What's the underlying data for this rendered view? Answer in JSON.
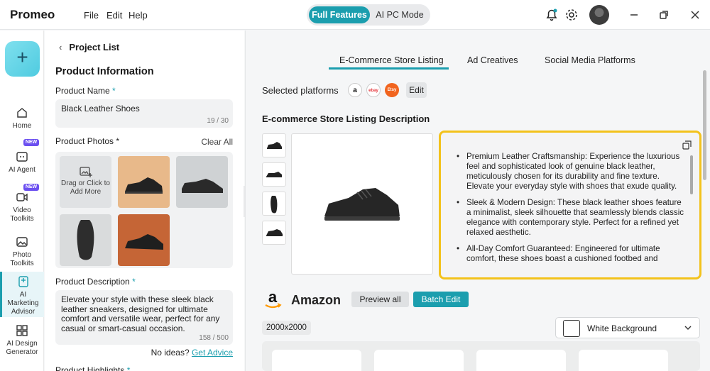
{
  "app": {
    "title": "Promeo"
  },
  "menu": {
    "file": "File",
    "edit": "Edit",
    "help": "Help"
  },
  "mode": {
    "active": "Full Features",
    "inactive": "AI PC Mode"
  },
  "rail": {
    "create_symbol": "+",
    "items": [
      {
        "label": "Home",
        "icon": "home-icon"
      },
      {
        "label": "AI Agent",
        "icon": "ai-agent-icon",
        "badge": "NEW"
      },
      {
        "label": "Video Toolkits",
        "icon": "video-icon",
        "badge": "NEW"
      },
      {
        "label": "Photo Toolkits",
        "icon": "photo-icon"
      },
      {
        "label": "AI Marketing Advisor",
        "icon": "marketing-icon",
        "active": true
      },
      {
        "label": "AI Design Generator",
        "icon": "design-icon"
      }
    ]
  },
  "form": {
    "back": "Project List",
    "section_title": "Product Information",
    "product_name_label": "Product Name",
    "required_mark": "*",
    "product_name_value": "Black Leather Shoes",
    "product_name_counter": "19 / 30",
    "photos_label": "Product Photos",
    "clear_all": "Clear All",
    "upload_text": "Drag or Click to Add More",
    "description_label": "Product Description",
    "description_value": "Elevate your style with these sleek black leather sneakers, designed for ultimate comfort and versatile wear, perfect for any casual or smart-casual occasion.",
    "description_counter": "158 / 500",
    "no_ideas": "No ideas?",
    "get_advice": "Get Advice",
    "highlights_label": "Product Highlights"
  },
  "main": {
    "tabs": [
      {
        "label": "E-Commerce Store Listing",
        "active": true
      },
      {
        "label": "Ad Creatives"
      },
      {
        "label": "Social Media Platforms"
      }
    ],
    "platforms_label": "Selected platforms",
    "platform_icons": [
      "a",
      "ebay",
      "Etsy"
    ],
    "edit_label": "Edit",
    "description_title": "E-commerce Store Listing Description",
    "bullets": [
      "Premium Leather Craftsmanship: Experience the luxurious feel and sophisticated look of genuine black leather, meticulously chosen for its durability and fine texture. Elevate your everyday style with shoes that exude quality.",
      "Sleek & Modern Design: These black leather shoes feature a minimalist, sleek silhouette that seamlessly blends classic elegance with contemporary style. Perfect for a refined yet relaxed aesthetic.",
      "All-Day Comfort Guaranteed: Engineered for ultimate comfort, these shoes boast a cushioned footbed and"
    ],
    "marketplace_name": "Amazon",
    "preview_all": "Preview all",
    "batch_edit": "Batch Edit",
    "size": "2000x2000",
    "background_option": "White Background"
  },
  "colors": {
    "accent": "#1b9eae",
    "highlight": "#f3c21b",
    "badge": "#6b4ff0"
  }
}
